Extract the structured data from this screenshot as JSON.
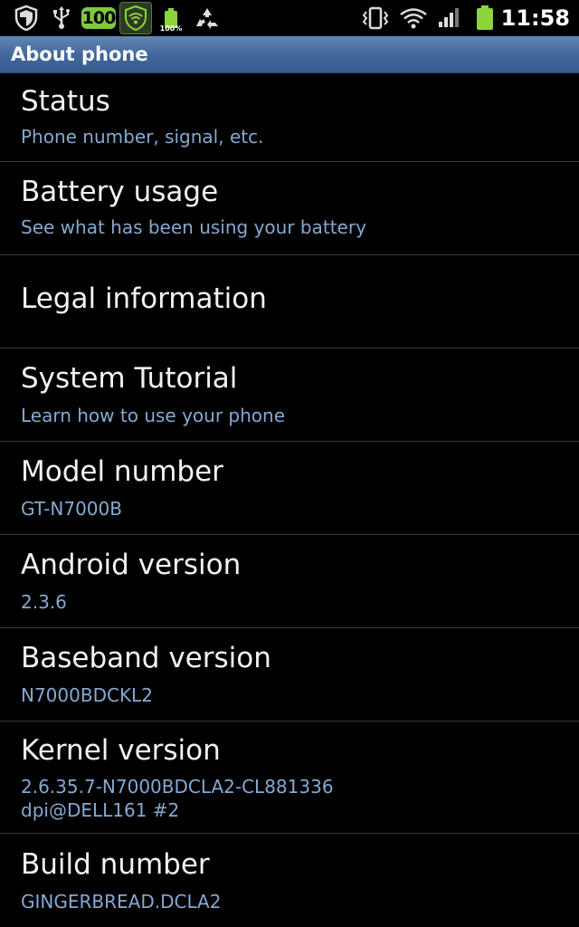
{
  "status_bar": {
    "icons": [
      "shield-icon",
      "usb-icon",
      "wifi-shield-icon",
      "battery-100-icon",
      "recycle-icon",
      "vibrate-icon",
      "wifi-icon",
      "signal-icon",
      "battery-icon"
    ],
    "badge_100": "100",
    "battery_percent": "100%",
    "clock": "11:58"
  },
  "header": {
    "title": "About phone"
  },
  "items": [
    {
      "title": "Status",
      "summary": "Phone number, signal, etc."
    },
    {
      "title": "Battery usage",
      "summary": "See what has been using your battery"
    },
    {
      "title": "Legal information",
      "summary": ""
    },
    {
      "title": "System Tutorial",
      "summary": "Learn how to use your phone"
    },
    {
      "title": "Model number",
      "summary": "GT-N7000B"
    },
    {
      "title": "Android version",
      "summary": "2.3.6"
    },
    {
      "title": "Baseband version",
      "summary": "N7000BDCKL2"
    },
    {
      "title": "Kernel version",
      "summary_line1": "2.6.35.7-N7000BDCLA2-CL881336",
      "summary_line2": "dpi@DELL161 #2"
    },
    {
      "title": "Build number",
      "summary": "GINGERBREAD.DCLA2"
    }
  ],
  "colors": {
    "title_bar": "#41679a",
    "summary_text": "#85a9d2",
    "divider": "#3a3a3a",
    "badge_green": "#7fc93a",
    "battery_green": "#8cd43a"
  }
}
